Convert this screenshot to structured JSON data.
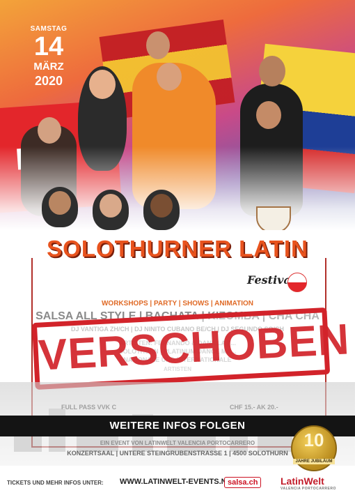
{
  "date": {
    "weekday": "SAMSTAG",
    "day": "14",
    "month": "MÄRZ",
    "year": "2020"
  },
  "title": "SOLOTHURNER LATIN",
  "subtitle": "Festival",
  "categories": "WORKSHOPS | PARTY | SHOWS | ANIMATION",
  "styles": "SALSA ALL STYLE | BACHATA | KIZOMBA | CHA CHA",
  "djs": "DJ VANTIGA ZH/CH | DJ NINITO CUBANO BE/CH | DJ SEGUNDO SO/CH",
  "artists_line1": "ARTISTEN: FERNANDO & DANIELA | ...",
  "artists_line2": "SOLOTHURN | PLATINUM DANCE MA...",
  "artists_line3": "NATIONALE UND INTERNATIONALE",
  "artists_line4": "ARTISTEN",
  "stamp": "VERSCHOBEN",
  "full_pass": "FULL PASS VVK C",
  "price": "CHF 15.- AK 20.-",
  "banner": "WEITERE INFOS FOLGEN",
  "organizer": "EIN EVENT VON LATINWELT VALENCIA PORTOCARRERO",
  "venue": "KONZERTSAAL | UNTERE STEINGRUBENSTRASSE 1 | 4500 SOLOTHURN",
  "jubilee": {
    "number": "10",
    "label": "JAHRE JUBILÄUM"
  },
  "footer": {
    "tickets": "TICKETS UND MEHR INFOS UNTER:",
    "url": "WWW.LATINWELT-EVENTS.NET",
    "partner": "salsa.ch",
    "brand": "LatinWelt",
    "brand_sub": "VALENCIA PORTOCARRERO"
  },
  "colors": {
    "accent": "#e8531e",
    "stamp": "#d2232a",
    "banner": "#141414"
  }
}
